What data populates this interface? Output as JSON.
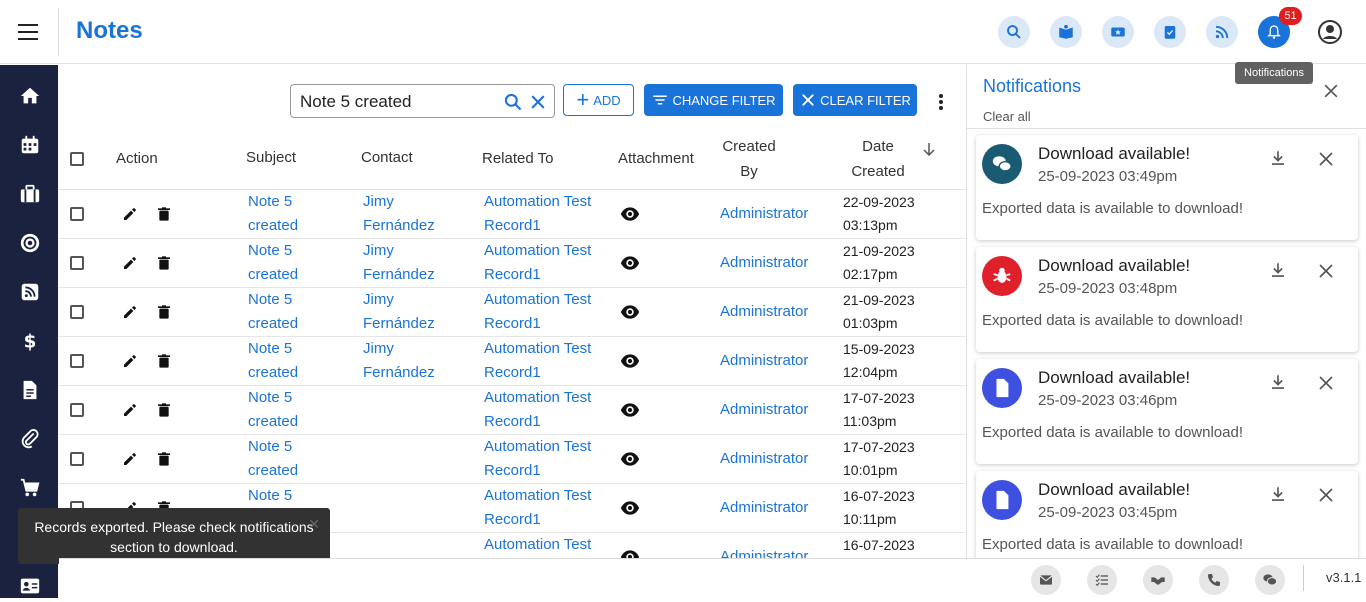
{
  "header": {
    "title": "Notes",
    "notification_count": "51",
    "tooltip": "Notifications",
    "icons": [
      "search-icon",
      "book-icon",
      "ticket-icon",
      "task-icon",
      "rss-icon",
      "bell-icon",
      "account-icon"
    ],
    "accent": "#1a73d9"
  },
  "sidebar": {
    "items": [
      "home-icon",
      "calendar-icon",
      "briefcase-icon",
      "target-icon",
      "rss-icon",
      "dollar-icon",
      "document-icon",
      "attachment-icon",
      "cart-icon",
      "contact-card-icon"
    ],
    "bg": "#1b2240"
  },
  "toolbar": {
    "search_value": "Note 5 created",
    "add_label": "ADD",
    "change_filter_label": "CHANGE FILTER",
    "clear_filter_label": "CLEAR FILTER"
  },
  "table": {
    "columns": {
      "action": "Action",
      "subject": "Subject",
      "contact": "Contact",
      "related_to": "Related To",
      "attachment": "Attachment",
      "created_by_1": "Created",
      "created_by_2": "By",
      "date_created_1": "Date",
      "date_created_2": "Created"
    },
    "rows": [
      {
        "subject1": "Note 5",
        "subject2": "created",
        "contact1": "Jimy",
        "contact2": "Fernández",
        "related1": "Automation Test",
        "related2": "Record1",
        "created_by": "Administrator",
        "date": "22-09-2023",
        "time": "03:13pm"
      },
      {
        "subject1": "Note 5",
        "subject2": "created",
        "contact1": "Jimy",
        "contact2": "Fernández",
        "related1": "Automation Test",
        "related2": "Record1",
        "created_by": "Administrator",
        "date": "21-09-2023",
        "time": "02:17pm"
      },
      {
        "subject1": "Note 5",
        "subject2": "created",
        "contact1": "Jimy",
        "contact2": "Fernández",
        "related1": "Automation Test",
        "related2": "Record1",
        "created_by": "Administrator",
        "date": "21-09-2023",
        "time": "01:03pm"
      },
      {
        "subject1": "Note 5",
        "subject2": "created",
        "contact1": "Jimy",
        "contact2": "Fernández",
        "related1": "Automation Test",
        "related2": "Record1",
        "created_by": "Administrator",
        "date": "15-09-2023",
        "time": "12:04pm"
      },
      {
        "subject1": "Note 5",
        "subject2": "created",
        "contact1": "",
        "contact2": "",
        "related1": "Automation Test",
        "related2": "Record1",
        "created_by": "Administrator",
        "date": "17-07-2023",
        "time": "11:03pm"
      },
      {
        "subject1": "Note 5",
        "subject2": "created",
        "contact1": "",
        "contact2": "",
        "related1": "Automation Test",
        "related2": "Record1",
        "created_by": "Administrator",
        "date": "17-07-2023",
        "time": "10:01pm"
      },
      {
        "subject1": "Note 5",
        "subject2": "",
        "contact1": "",
        "contact2": "",
        "related1": "Automation Test",
        "related2": "Record1",
        "created_by": "Administrator",
        "date": "16-07-2023",
        "time": "10:11pm"
      },
      {
        "subject1": "",
        "subject2": "",
        "contact1": "",
        "contact2": "",
        "related1": "Automation Test",
        "related2": "",
        "created_by": "Administrator",
        "date": "16-07-2023",
        "time": ""
      }
    ]
  },
  "toast": {
    "message": "Records exported. Please check notifications section to download."
  },
  "notifications": {
    "title": "Notifications",
    "clear_all": "Clear all",
    "items": [
      {
        "title": "Download available!",
        "date": "25-09-2023 03:49pm",
        "message": "Exported data is available to download!",
        "avatar_icon": "chat-icon",
        "avatar_color": "#1b5a73"
      },
      {
        "title": "Download available!",
        "date": "25-09-2023 03:48pm",
        "message": "Exported data is available to download!",
        "avatar_icon": "bug-icon",
        "avatar_color": "#e0202a"
      },
      {
        "title": "Download available!",
        "date": "25-09-2023 03:46pm",
        "message": "Exported data is available to download!",
        "avatar_icon": "document-icon",
        "avatar_color": "#3d50e0"
      },
      {
        "title": "Download available!",
        "date": "25-09-2023 03:45pm",
        "message": "Exported data is available to download!",
        "avatar_icon": "document-icon",
        "avatar_color": "#3d50e0"
      }
    ]
  },
  "footer": {
    "icons": [
      "email-icon",
      "checklist-icon",
      "handshake-icon",
      "phone-icon",
      "chat-icon"
    ],
    "version": "v3.1.1"
  }
}
